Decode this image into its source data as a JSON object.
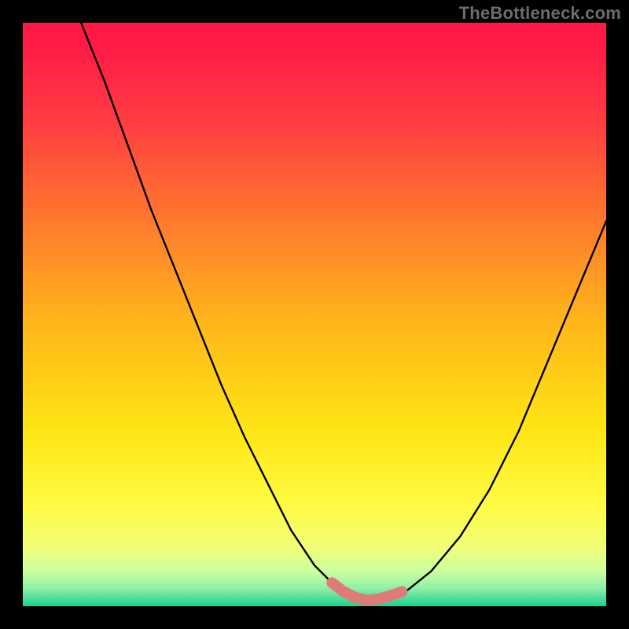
{
  "watermark": "TheBottleneck.com",
  "chart_data": {
    "type": "line",
    "title": "",
    "xlabel": "",
    "ylabel": "",
    "xlim": [
      0,
      100
    ],
    "ylim": [
      0,
      100
    ],
    "grid": false,
    "legend": false,
    "background_gradient": {
      "direction": "vertical",
      "stops": [
        {
          "pos": 0,
          "color": "#ff1745"
        },
        {
          "pos": 18,
          "color": "#ff4040"
        },
        {
          "pos": 35,
          "color": "#ff7d2c"
        },
        {
          "pos": 52,
          "color": "#ffb81a"
        },
        {
          "pos": 70,
          "color": "#ffe615"
        },
        {
          "pos": 83,
          "color": "#fffb45"
        },
        {
          "pos": 94,
          "color": "#ccffa0"
        },
        {
          "pos": 100,
          "color": "#1dd390"
        }
      ]
    },
    "series": [
      {
        "name": "bottleneck-curve",
        "color": "#000000",
        "x": [
          10,
          14,
          18,
          22,
          26,
          30,
          34,
          38,
          42,
          46,
          50,
          53,
          56,
          59,
          62,
          65,
          70,
          75,
          80,
          85,
          90,
          95,
          100
        ],
        "y": [
          100,
          90,
          79,
          68,
          58,
          48,
          38,
          29,
          21,
          13,
          7,
          4,
          2,
          1,
          1,
          2,
          6,
          12,
          20,
          30,
          42,
          54,
          66
        ]
      }
    ],
    "highlight_segment": {
      "name": "optimal-range",
      "color": "#e07a78",
      "x": [
        53,
        55,
        57,
        59,
        61,
        63,
        65
      ],
      "y": [
        4,
        2.5,
        1.5,
        1,
        1.2,
        1.8,
        2.5
      ]
    }
  }
}
